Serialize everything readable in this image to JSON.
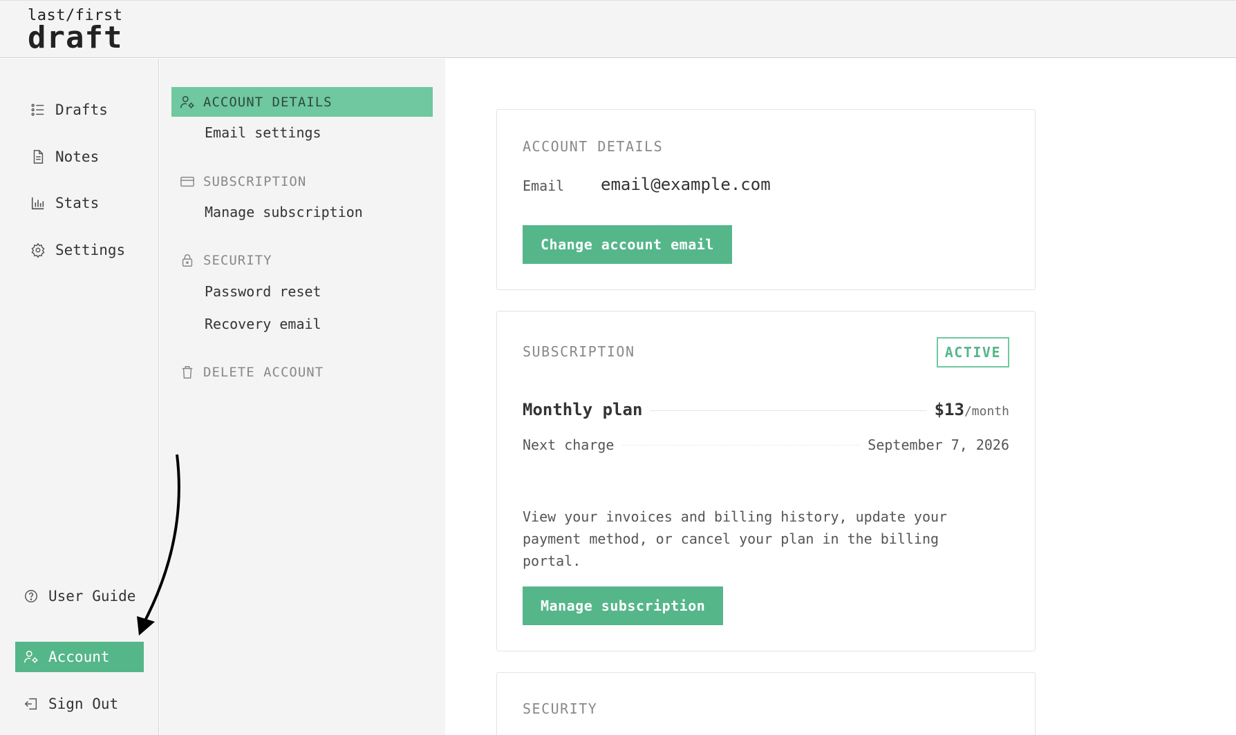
{
  "logo": {
    "line1": "last/first",
    "line2": "draft"
  },
  "sidebar": {
    "items": [
      {
        "label": "Drafts",
        "icon": "list-icon"
      },
      {
        "label": "Notes",
        "icon": "document-icon"
      },
      {
        "label": "Stats",
        "icon": "bar-chart-icon"
      },
      {
        "label": "Settings",
        "icon": "gear-icon"
      }
    ],
    "bottom": [
      {
        "label": "User Guide",
        "icon": "help-circle-icon"
      },
      {
        "label": "Account",
        "icon": "user-gear-icon",
        "active": true
      },
      {
        "label": "Sign Out",
        "icon": "sign-out-icon"
      }
    ]
  },
  "subnav": {
    "account_details": "ACCOUNT DETAILS",
    "email_settings": "Email settings",
    "subscription": "SUBSCRIPTION",
    "manage_subscription": "Manage subscription",
    "security": "SECURITY",
    "password_reset": "Password reset",
    "recovery_email": "Recovery email",
    "delete_account": "DELETE ACCOUNT"
  },
  "account_card": {
    "title": "ACCOUNT DETAILS",
    "email_label": "Email",
    "email_value": "email@example.com",
    "change_button": "Change account email"
  },
  "subscription_card": {
    "title": "SUBSCRIPTION",
    "status": "ACTIVE",
    "plan_name": "Monthly plan",
    "price": "$13",
    "price_unit": "/month",
    "next_charge_label": "Next charge",
    "next_charge_date": "September 7, 2026",
    "description": "View your invoices and billing history, update your payment method, or cancel your plan in the billing portal.",
    "manage_button": "Manage subscription"
  },
  "security_card": {
    "title": "SECURITY"
  },
  "colors": {
    "accent": "#55b68a",
    "accent_light": "#6fc89f",
    "panel_bg": "#f4f4f4"
  }
}
